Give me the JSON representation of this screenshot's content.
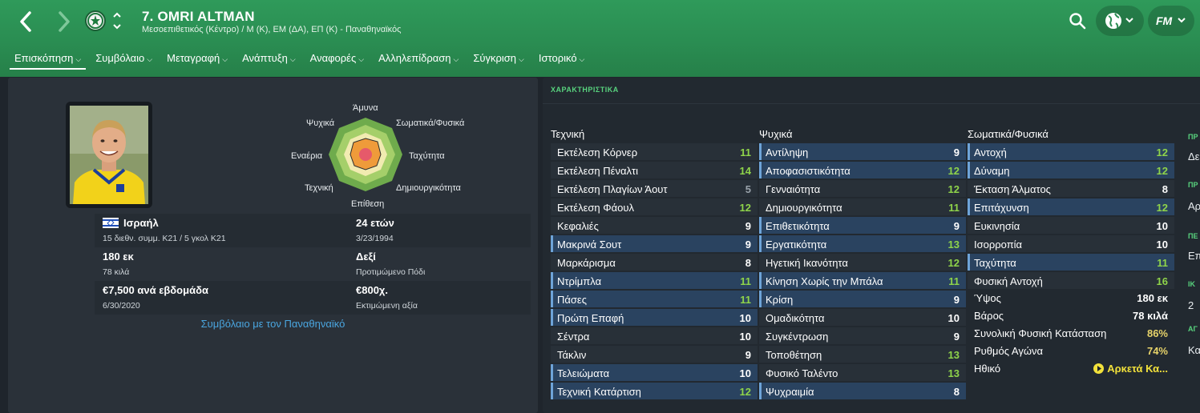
{
  "header": {
    "title": "7. OMRI ALTMAN",
    "subtitle": "Μεσοεπιθετικός (Κέντρο) / Μ (Κ), ΕΜ (ΔΑ), ΕΠ (Κ) - Παναθηναϊκός",
    "brand_label": "FM",
    "icons": [
      "back-arrow-icon",
      "forward-arrow-icon",
      "club-crest-icon",
      "up-down-chevron-icon",
      "search-icon",
      "globe-icon",
      "chevron-down-icon"
    ]
  },
  "tabs": [
    {
      "label": "Επισκόπηση",
      "active": true
    },
    {
      "label": "Συμβόλαιο",
      "active": false
    },
    {
      "label": "Μεταγραφή",
      "active": false
    },
    {
      "label": "Ανάπτυξη",
      "active": false
    },
    {
      "label": "Αναφορές",
      "active": false
    },
    {
      "label": "Αλληλεπίδραση",
      "active": false
    },
    {
      "label": "Σύγκριση",
      "active": false
    },
    {
      "label": "Ιστορικό",
      "active": false
    }
  ],
  "radar": {
    "top": "Άμυνα",
    "top_right": "Σωματικά/Φυσικά",
    "right": "Ταχύτητα",
    "bottom_right": "Δημιουργικότητα",
    "bottom": "Επίθεση",
    "bottom_left": "Τεχνική",
    "left": "Εναέρια",
    "top_left": "Ψυχικά"
  },
  "bio": {
    "nationality": "Ισραήλ",
    "caps": "15 διεθν. συμμ. Κ21 / 5 γκολ Κ21",
    "age": "24 ετών",
    "dob": "3/23/1994",
    "height": "180 εκ",
    "weight": "78 κιλά",
    "foot": "Δεξί",
    "foot_label": "Προτιμώμενο Πόδι",
    "wage": "€7,500 ανά εβδομάδα",
    "contract_end": "6/30/2020",
    "value": "€800χ.",
    "value_label": "Εκτιμώμενη αξία",
    "contract_link": "Συμβόλαιο με τον Παναθηναϊκό"
  },
  "attributes": {
    "header": "ΧΑΡΑΚΤΗΡΙΣΤΙΚΑ",
    "columns": [
      {
        "title": "Τεχνική",
        "rows": [
          {
            "name": "Εκτέλεση Κόρνερ",
            "value": "11",
            "color": "#8fd44a",
            "hl": false
          },
          {
            "name": "Εκτέλεση Πέναλτι",
            "value": "14",
            "color": "#8fd44a",
            "hl": false
          },
          {
            "name": "Εκτέλεση Πλαγίων Άουτ",
            "value": "5",
            "color": "#9aa3ab",
            "hl": false
          },
          {
            "name": "Εκτέλεση Φάουλ",
            "value": "12",
            "color": "#8fd44a",
            "hl": false
          },
          {
            "name": "Κεφαλιές",
            "value": "9",
            "color": "#ffffff",
            "hl": false
          },
          {
            "name": "Μακρινά Σουτ",
            "value": "9",
            "color": "#ffffff",
            "hl": true
          },
          {
            "name": "Μαρκάρισμα",
            "value": "8",
            "color": "#ffffff",
            "hl": false
          },
          {
            "name": "Ντρίμπλα",
            "value": "11",
            "color": "#8fd44a",
            "hl": true
          },
          {
            "name": "Πάσες",
            "value": "11",
            "color": "#8fd44a",
            "hl": true
          },
          {
            "name": "Πρώτη Επαφή",
            "value": "10",
            "color": "#ffffff",
            "hl": true
          },
          {
            "name": "Σέντρα",
            "value": "10",
            "color": "#ffffff",
            "hl": false
          },
          {
            "name": "Τάκλιν",
            "value": "9",
            "color": "#ffffff",
            "hl": false
          },
          {
            "name": "Τελειώματα",
            "value": "10",
            "color": "#ffffff",
            "hl": true
          },
          {
            "name": "Τεχνική Κατάρτιση",
            "value": "12",
            "color": "#8fd44a",
            "hl": true
          }
        ]
      },
      {
        "title": "Ψυχικά",
        "rows": [
          {
            "name": "Αντίληψη",
            "value": "9",
            "color": "#ffffff",
            "hl": true
          },
          {
            "name": "Αποφασιστικότητα",
            "value": "12",
            "color": "#8fd44a",
            "hl": true
          },
          {
            "name": "Γενναιότητα",
            "value": "12",
            "color": "#8fd44a",
            "hl": false
          },
          {
            "name": "Δημιουργικότητα",
            "value": "11",
            "color": "#8fd44a",
            "hl": false
          },
          {
            "name": "Επιθετικότητα",
            "value": "9",
            "color": "#ffffff",
            "hl": true
          },
          {
            "name": "Εργατικότητα",
            "value": "13",
            "color": "#8fd44a",
            "hl": true
          },
          {
            "name": "Ηγετική Ικανότητα",
            "value": "12",
            "color": "#8fd44a",
            "hl": false
          },
          {
            "name": "Κίνηση Χωρίς την Μπάλα",
            "value": "11",
            "color": "#8fd44a",
            "hl": true
          },
          {
            "name": "Κρίση",
            "value": "9",
            "color": "#ffffff",
            "hl": true
          },
          {
            "name": "Ομαδικότητα",
            "value": "10",
            "color": "#ffffff",
            "hl": false
          },
          {
            "name": "Συγκέντρωση",
            "value": "9",
            "color": "#ffffff",
            "hl": false
          },
          {
            "name": "Τοποθέτηση",
            "value": "13",
            "color": "#8fd44a",
            "hl": false
          },
          {
            "name": "Φυσικό Ταλέντο",
            "value": "13",
            "color": "#8fd44a",
            "hl": false
          },
          {
            "name": "Ψυχραιμία",
            "value": "8",
            "color": "#ffffff",
            "hl": true
          }
        ]
      },
      {
        "title": "Σωματικά/Φυσικά",
        "rows": [
          {
            "name": "Αντοχή",
            "value": "12",
            "color": "#8fd44a",
            "hl": true
          },
          {
            "name": "Δύναμη",
            "value": "12",
            "color": "#8fd44a",
            "hl": true
          },
          {
            "name": "Έκταση Άλματος",
            "value": "8",
            "color": "#ffffff",
            "hl": false
          },
          {
            "name": "Επιτάχυνση",
            "value": "12",
            "color": "#8fd44a",
            "hl": true
          },
          {
            "name": "Ευκινησία",
            "value": "10",
            "color": "#ffffff",
            "hl": false
          },
          {
            "name": "Ισορροπία",
            "value": "10",
            "color": "#ffffff",
            "hl": false
          },
          {
            "name": "Ταχύτητα",
            "value": "11",
            "color": "#8fd44a",
            "hl": true
          },
          {
            "name": "Φυσική Αντοχή",
            "value": "16",
            "color": "#8fd44a",
            "hl": false
          }
        ]
      }
    ],
    "extra": [
      {
        "label": "Ύψος",
        "value": "180 εκ",
        "color": "#ffffff"
      },
      {
        "label": "Βάρος",
        "value": "78 κιλά",
        "color": "#ffffff"
      },
      {
        "label": "Συνολική Φυσική Κατάσταση",
        "value": "86%",
        "color": "#e7d36a"
      },
      {
        "label": "Ρυθμός Αγώνα",
        "value": "74%",
        "color": "#e7d36a"
      },
      {
        "label": "Ηθικό",
        "value": "Αρκετά Κα...",
        "color": "#f2e13b"
      }
    ]
  },
  "side_column": {
    "items": [
      {
        "kind": "head",
        "text": "ΠΡ"
      },
      {
        "kind": "text",
        "text": "Δε"
      },
      {
        "kind": "head",
        "text": "ΠΡ"
      },
      {
        "kind": "text",
        "text": "Αρ"
      },
      {
        "kind": "head",
        "text": "ΠΕ"
      },
      {
        "kind": "text",
        "text": "Επ"
      },
      {
        "kind": "head",
        "text": "ΙΚ"
      },
      {
        "kind": "text",
        "text": "2"
      },
      {
        "kind": "head",
        "text": "ΑΓ"
      },
      {
        "kind": "text",
        "text": "Κα"
      }
    ]
  }
}
